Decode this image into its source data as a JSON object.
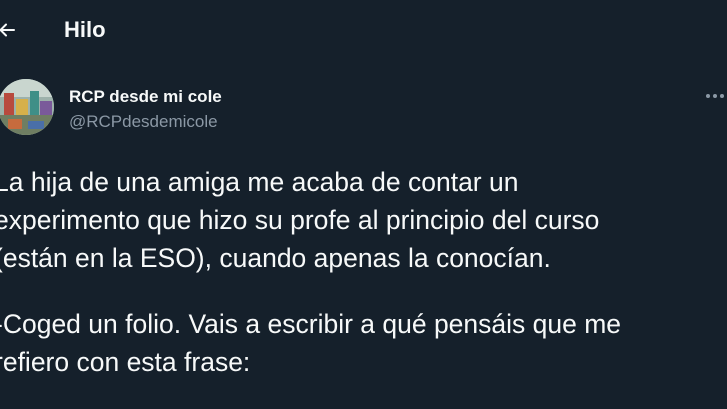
{
  "header": {
    "title": "Hilo",
    "back_icon": "arrow-left-icon"
  },
  "author": {
    "name": "RCP desde mi cole",
    "handle": "@RCPdesdemicole",
    "avatar_icon": "avatar-photo"
  },
  "tweet": {
    "paragraph1": [
      "La hija de una amiga me acaba de contar un",
      "experimento que hizo su profe al principio del curso",
      "(están en la ESO), cuando apenas la conocían."
    ],
    "paragraph2": [
      "-Coged un folio. Vais a escribir a qué pensáis que me",
      "refiero con esta frase:"
    ]
  },
  "colors": {
    "background": "#15202b",
    "text": "#f7f9f9",
    "secondary_text": "#8b98a5"
  },
  "more_icon": "more-options-icon"
}
